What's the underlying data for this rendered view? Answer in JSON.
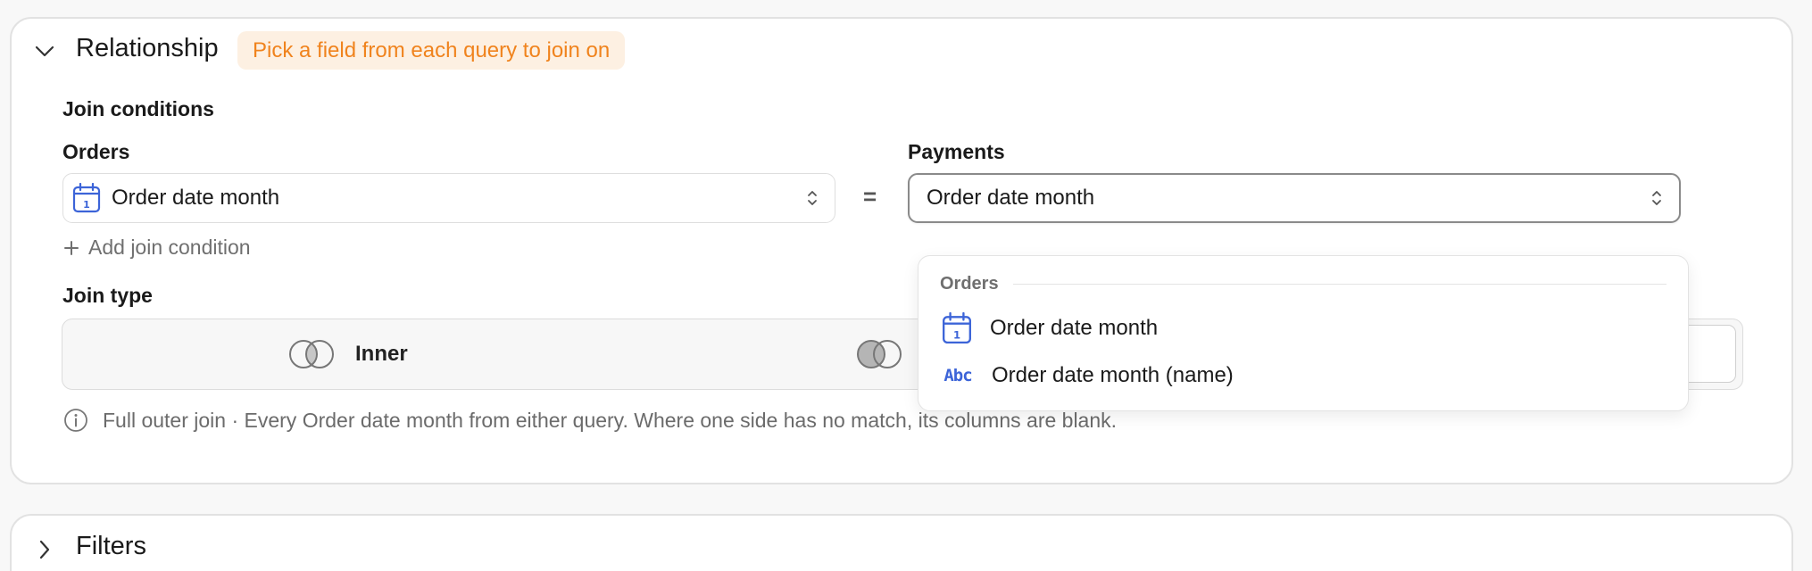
{
  "relationship": {
    "title": "Relationship",
    "hint": "Pick a field from each query to join on",
    "join_conditions_label": "Join conditions",
    "left": {
      "query_label": "Orders",
      "selected_value": "Order date month",
      "icon": "calendar-icon"
    },
    "equals_symbol": "=",
    "right": {
      "query_label": "Payments",
      "selected_value": "Order date month"
    },
    "add_join_condition": "Add join condition",
    "join_type_label": "Join type",
    "join_types": [
      {
        "label": "Inner",
        "icon": "venn-inner-icon"
      },
      {
        "label": "",
        "icon": "venn-left-icon"
      }
    ],
    "info_text": "Full outer join · Every Order date month from either query. Where one side has no match, its columns are blank."
  },
  "dropdown": {
    "group_label": "Orders",
    "options": [
      {
        "label": "Order date month",
        "icon": "calendar-icon"
      },
      {
        "label": "Order date month (name)",
        "icon": "abc-text-icon",
        "icon_text": "Abc"
      }
    ]
  },
  "filters": {
    "title": "Filters"
  },
  "colors": {
    "accent_orange": "#f0831d",
    "hint_bg": "#fdf0e2",
    "icon_blue": "#3c64d8",
    "muted_text": "#6b6b6b"
  }
}
